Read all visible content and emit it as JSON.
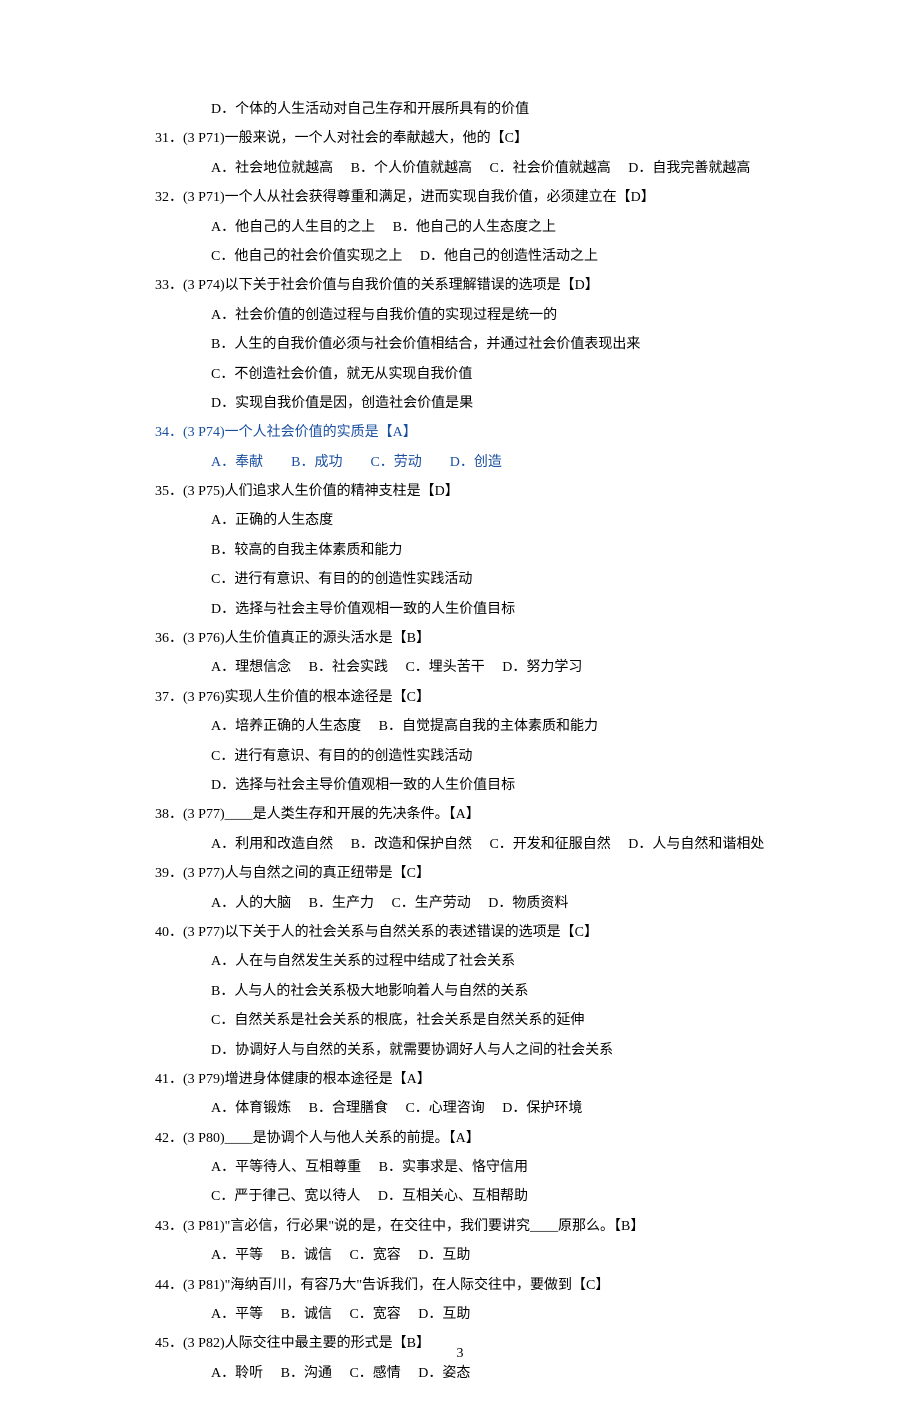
{
  "orphan_option": "D．个体的人生活动对自己生存和开展所具有的价值",
  "questions": [
    {
      "num": "31．",
      "ref": "(3 P71)",
      "stem": "一般来说，一个人对社会的奉献越大，他的【C】",
      "options_lines": [
        "A．社会地位就越高　 B．个人价值就越高　 C．社会价值就越高　 D．自我完善就越高"
      ]
    },
    {
      "num": "32．",
      "ref": "(3 P71)",
      "stem": "一个人从社会获得尊重和满足，进而实现自我价值，必须建立在【D】",
      "options_lines": [
        "A．他自己的人生目的之上　 B．他自己的人生态度之上",
        "C．他自己的社会价值实现之上　 D．他自己的创造性活动之上"
      ]
    },
    {
      "num": "33．",
      "ref": "(3 P74)",
      "stem": "以下关于社会价值与自我价值的关系理解错误的选项是【D】",
      "options_lines": [
        "A．社会价值的创造过程与自我价值的实现过程是统一的",
        "B．人生的自我价值必须与社会价值相结合，并通过社会价值表现出来",
        "C．不创造社会价值，就无从实现自我价值",
        "D．实现自我价值是因，创造社会价值是果"
      ]
    },
    {
      "num": "34．",
      "ref": "(3 P74)",
      "stem": "一个人社会价值的实质是【A】",
      "highlight": true,
      "options_lines": [
        "A．奉献　　B．成功　　C．劳动　　D．创造"
      ]
    },
    {
      "num": "35．",
      "ref": "(3 P75)",
      "stem": "人们追求人生价值的精神支柱是【D】",
      "options_lines": [
        "A．正确的人生态度",
        "B．较高的自我主体素质和能力",
        "C．进行有意识、有目的的创造性实践活动",
        "D．选择与社会主导价值观相一致的人生价值目标"
      ]
    },
    {
      "num": "36．",
      "ref": "(3 P76)",
      "stem": "人生价值真正的源头活水是【B】",
      "options_lines": [
        "A．理想信念　 B．社会实践　 C．埋头苦干　 D．努力学习"
      ]
    },
    {
      "num": "37．",
      "ref": "(3 P76)",
      "stem": "实现人生价值的根本途径是【C】",
      "options_lines": [
        "A．培养正确的人生态度　 B．自觉提高自我的主体素质和能力",
        "C．进行有意识、有目的的创造性实践活动",
        "D．选择与社会主导价值观相一致的人生价值目标"
      ]
    },
    {
      "num": "38．",
      "ref": "(3 P77)",
      "stem": "____是人类生存和开展的先决条件。【A】",
      "options_lines": [
        "A．利用和改造自然　 B．改造和保护自然　 C．开发和征服自然　 D．人与自然和谐相处"
      ]
    },
    {
      "num": "39．",
      "ref": "(3 P77)",
      "stem": "人与自然之间的真正纽带是【C】",
      "options_lines": [
        "A．人的大脑　 B．生产力　 C．生产劳动　 D．物质资料"
      ]
    },
    {
      "num": "40．",
      "ref": "(3 P77)",
      "stem": "以下关于人的社会关系与自然关系的表述错误的选项是【C】",
      "options_lines": [
        "A．人在与自然发生关系的过程中结成了社会关系",
        "B．人与人的社会关系极大地影响着人与自然的关系",
        "C．自然关系是社会关系的根底，社会关系是自然关系的延伸",
        "D．协调好人与自然的关系，就需要协调好人与人之间的社会关系"
      ]
    },
    {
      "num": "41．",
      "ref": "(3 P79)",
      "stem": "增进身体健康的根本途径是【A】",
      "options_lines": [
        "A．体育锻炼　 B．合理膳食　 C．心理咨询　 D．保护环境"
      ]
    },
    {
      "num": "42．",
      "ref": "(3 P80)",
      "stem": "____是协调个人与他人关系的前提。【A】",
      "options_lines": [
        "A．平等待人、互相尊重　 B．实事求是、恪守信用",
        "C．严于律己、宽以待人　 D．互相关心、互相帮助"
      ]
    },
    {
      "num": "43．",
      "ref": "(3 P81)",
      "stem": "\"言必信，行必果\"说的是，在交往中，我们要讲究____原那么。【B】",
      "options_lines": [
        "A．平等　 B．诚信　 C．宽容　 D．互助"
      ]
    },
    {
      "num": "44．",
      "ref": "(3 P81)",
      "stem": "\"海纳百川，有容乃大\"告诉我们，在人际交往中，要做到【C】",
      "options_lines": [
        "A．平等　 B．诚信　 C．宽容　 D．互助"
      ]
    },
    {
      "num": "45．",
      "ref": "(3 P82)",
      "stem": "人际交往中最主要的形式是【B】",
      "options_lines": [
        "A．聆听　 B．沟通　 C．感情　 D．姿态"
      ]
    }
  ],
  "page_number": "3"
}
